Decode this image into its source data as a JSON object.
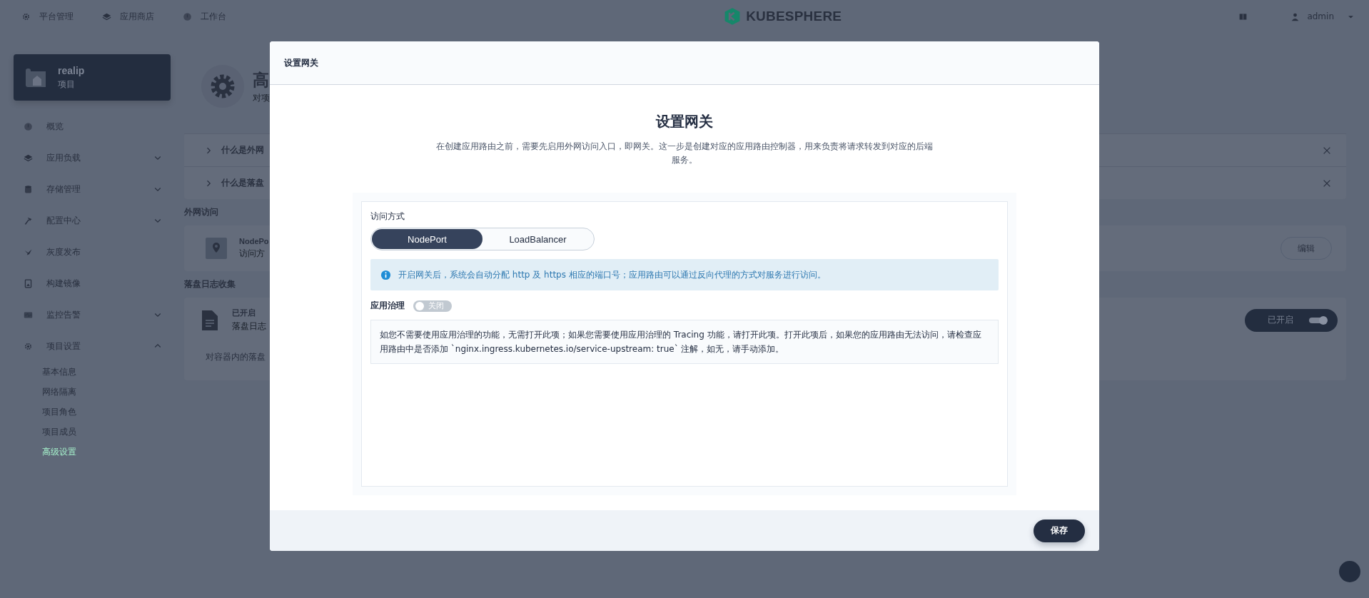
{
  "top_nav": {
    "items": [
      {
        "label": "平台管理"
      },
      {
        "label": "应用商店"
      },
      {
        "label": "工作台"
      }
    ],
    "logo": "KUBESPHERE",
    "user": "admin"
  },
  "sidebar": {
    "project": {
      "name": "realip",
      "type": "项目"
    },
    "items": [
      {
        "label": "概览",
        "kind": "link"
      },
      {
        "label": "应用负载",
        "kind": "group",
        "expanded": false
      },
      {
        "label": "存储管理",
        "kind": "group",
        "expanded": false
      },
      {
        "label": "配置中心",
        "kind": "group",
        "expanded": false
      },
      {
        "label": "灰度发布",
        "kind": "link"
      },
      {
        "label": "构建镜像",
        "kind": "link"
      },
      {
        "label": "监控告警",
        "kind": "group",
        "expanded": false
      },
      {
        "label": "项目设置",
        "kind": "group",
        "expanded": true,
        "children": [
          {
            "label": "基本信息",
            "selected": false
          },
          {
            "label": "网络隔离",
            "selected": false
          },
          {
            "label": "项目角色",
            "selected": false
          },
          {
            "label": "项目成员",
            "selected": false
          },
          {
            "label": "高级设置",
            "selected": true
          }
        ]
      }
    ]
  },
  "page": {
    "title": "高",
    "description": "对项",
    "tips": [
      {
        "title": "什么是外网"
      },
      {
        "title": "什么是落盘"
      }
    ],
    "gateway_section": {
      "label": "外网访问",
      "name": "NodePo",
      "detail": "访问方",
      "edit_button": "编辑"
    },
    "log_section": {
      "label": "落盘日志收集",
      "status": "已开启",
      "detail": "落盘日志",
      "toggle": {
        "label": "已开启",
        "on": true
      },
      "note": "对容器内的落盘"
    }
  },
  "modal": {
    "title": "设置网关",
    "heading": "设置网关",
    "description": "在创建应用路由之前，需要先启用外网访问入口，即网关。这一步是创建对应的应用路由控制器，用来负责将请求转发到对应的后端服务。",
    "access_mode": {
      "label": "访问方式",
      "options": [
        {
          "label": "NodePort",
          "selected": true
        },
        {
          "label": "LoadBalancer",
          "selected": false
        }
      ]
    },
    "info": "开启网关后，系统会自动分配 http 及 https 相应的端口号；应用路由可以通过反向代理的方式对服务进行访问。",
    "governance": {
      "label": "应用治理",
      "toggle": {
        "label": "关闭",
        "on": false
      }
    },
    "note": "如您不需要使用应用治理的功能，无需打开此项；如果您需要使用应用治理的 Tracing 功能，请打开此项。打开此项后，如果您的应用路由无法访问，请检查应用路由中是否添加 `nginx.ingress.kubernetes.io/service-upstream: true` 注解，如无，请手动添加。",
    "save_button": "保存"
  }
}
